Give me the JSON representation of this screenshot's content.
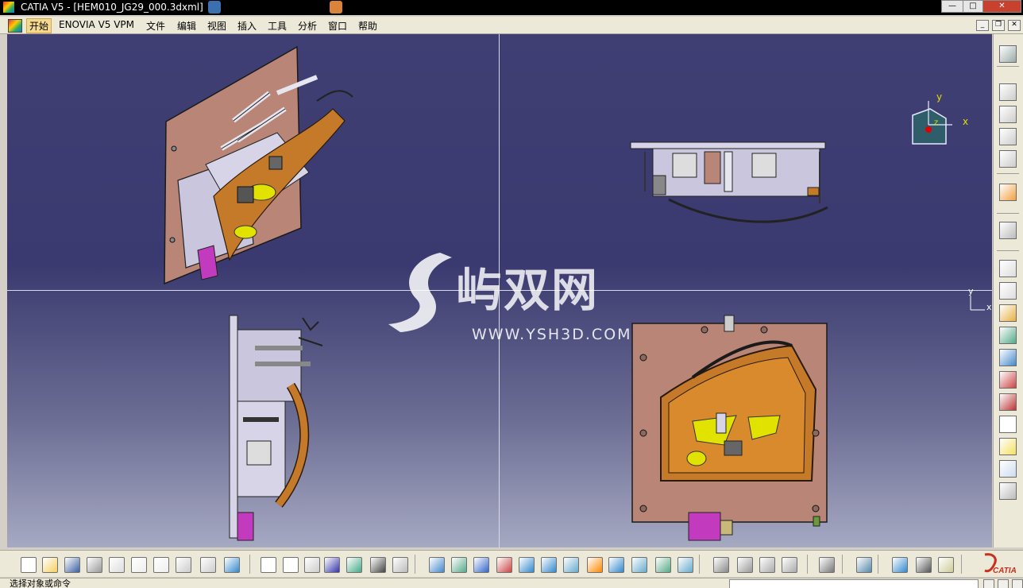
{
  "window": {
    "title": "CATIA V5 - [HEM010_JG29_000.3dxml]",
    "controls": {
      "minimize": "—",
      "maximize": "□",
      "close": "✕"
    }
  },
  "menubar": {
    "items": [
      "开始",
      "ENOVIA V5 VPM",
      "文件",
      "编辑",
      "视图",
      "插入",
      "工具",
      "分析",
      "窗口",
      "帮助"
    ],
    "doc_controls": {
      "minimize": "_",
      "restore": "❐",
      "close": "✕"
    }
  },
  "viewport": {
    "compass": {
      "x": "x",
      "y": "y",
      "z": "z"
    },
    "mini_axis": {
      "y": "y",
      "x": "x"
    },
    "watermark": {
      "text": "屿双网",
      "url": "WWW.YSH3D.COM"
    },
    "views": [
      "isometric-view",
      "top-view",
      "side-view",
      "front-view"
    ]
  },
  "right_toolbar": {
    "icons": [
      "gear-icon",
      "part-icon",
      "part-structure-icon",
      "part-link-icon",
      "part-copy-icon",
      "select-arrow-icon",
      "snap-arrow-icon",
      "settings-gear-icon",
      "gear-sheet-icon",
      "gear-orange-icon",
      "export-icon",
      "import-icon",
      "scissors-link-icon",
      "cut-icon",
      "text-a-icon",
      "tree-icon",
      "tree-search-icon",
      "gear-gray-icon"
    ]
  },
  "bottom_toolbar": {
    "icons": [
      "new-icon",
      "open-icon",
      "save-icon",
      "print-icon",
      "cut-icon",
      "copy-icon",
      "paste-icon",
      "undo-icon",
      "redo-icon",
      "help-icon",
      "formula-icon",
      "comment-icon",
      "measure-icon",
      "table-icon",
      "tree-icon",
      "lock-icon",
      "param-icon",
      "fly-icon",
      "fit-all-icon",
      "pan-icon",
      "rotate-icon",
      "zoom-in-icon",
      "zoom-out-icon",
      "normal-view-icon",
      "iso-view-icon",
      "cube-view-icon",
      "cylinder-icon",
      "render-icon",
      "shading-icon",
      "hide-icon",
      "swap-icon",
      "link-icon",
      "link2-icon",
      "camera-icon",
      "capture-icon",
      "distance-icon",
      "tool-icon",
      "bottle-icon"
    ],
    "brand": "CATIA"
  },
  "status": {
    "message": "选择对象或命令"
  },
  "colors": {
    "viewport_top": "#3f3f74",
    "viewport_bottom": "#a6a9c2",
    "plate": "#b98577",
    "frame": "#c9c6de",
    "fixture": "#c57a2a",
    "panel_yellow": "#e2e200",
    "magenta": "#c23bbf"
  }
}
